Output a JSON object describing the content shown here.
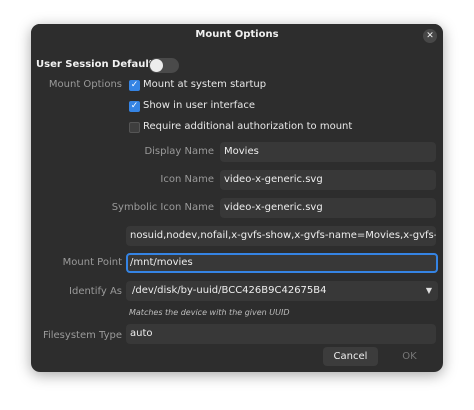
{
  "window": {
    "title": "Mount Options"
  },
  "session_defaults": {
    "label": "User Session Defaults",
    "enabled": false
  },
  "mount_options": {
    "label": "Mount Options",
    "checks": [
      {
        "label": "Mount at system startup",
        "checked": true
      },
      {
        "label": "Show in user interface",
        "checked": true
      },
      {
        "label": "Require additional authorization to mount",
        "checked": false
      }
    ]
  },
  "fields": {
    "display_name": {
      "label": "Display Name",
      "value": "Movies"
    },
    "icon_name": {
      "label": "Icon Name",
      "value": "video-x-generic.svg"
    },
    "symbolic_icon_name": {
      "label": "Symbolic Icon Name",
      "value": "video-x-generic.svg"
    },
    "options_value": "nosuid,nodev,nofail,x-gvfs-show,x-gvfs-name=Movies,x-gvfs-icon=vid",
    "mount_point": {
      "label": "Mount Point",
      "value": "/mnt/movies"
    },
    "identify_as": {
      "label": "Identify As",
      "value": "/dev/disk/by-uuid/BCC426B9C42675B4",
      "hint": "Matches the device with the given UUID"
    },
    "filesystem_type": {
      "label": "Filesystem Type",
      "value": "auto"
    }
  },
  "buttons": {
    "cancel": "Cancel",
    "ok": "OK"
  },
  "icons": {
    "close": "close-icon",
    "dropdown": "chevron-down-icon",
    "check": "checkmark-icon"
  },
  "colors": {
    "accent": "#3584e4",
    "background": "#2d2d2d"
  }
}
